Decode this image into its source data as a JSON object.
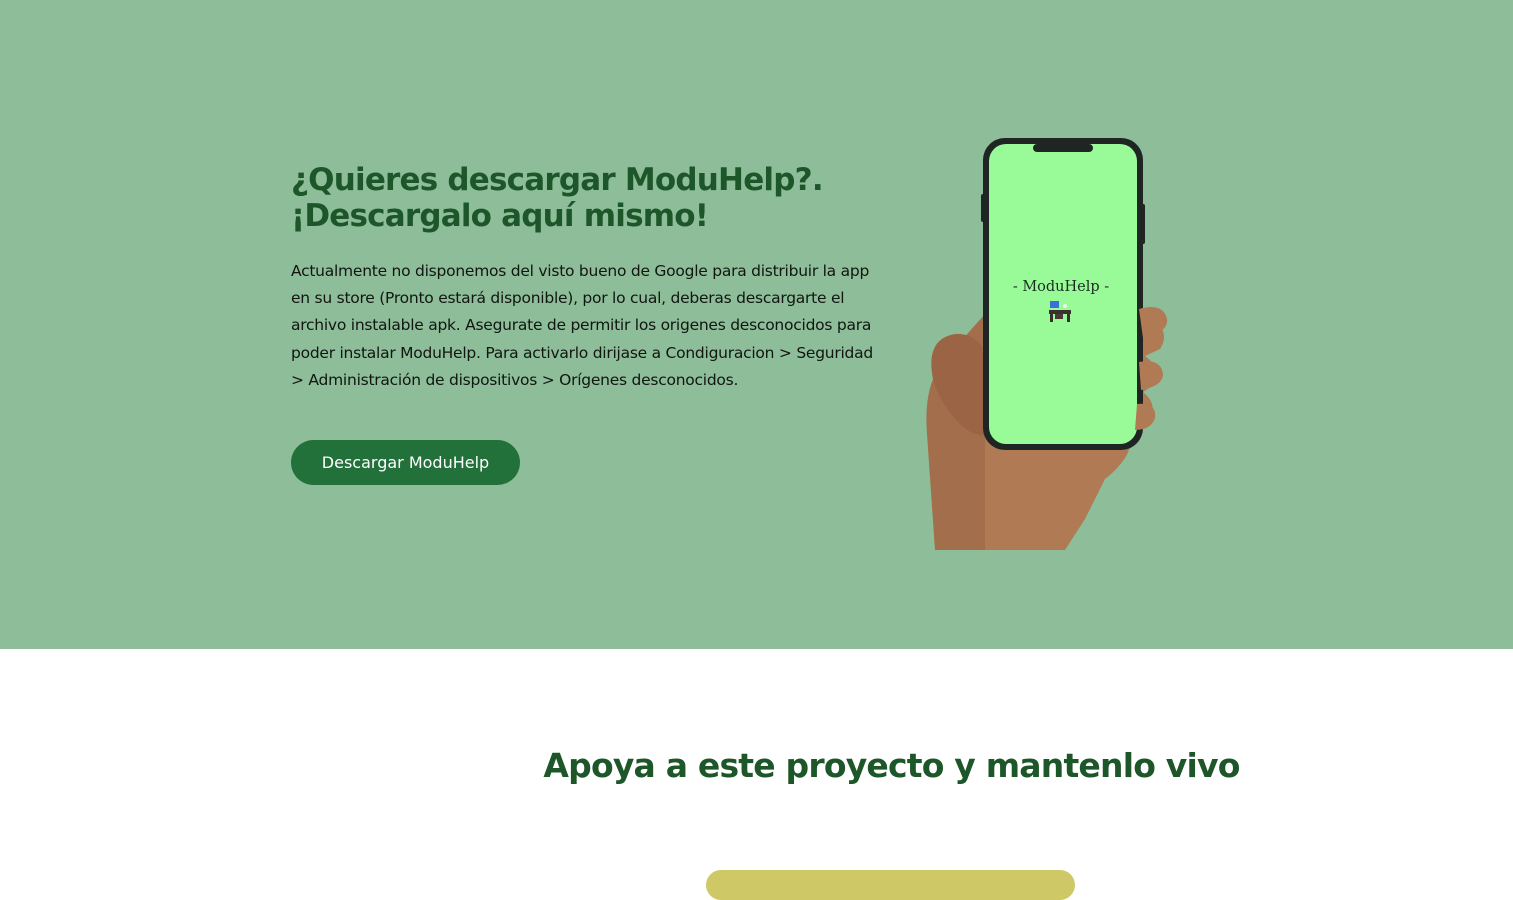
{
  "hero": {
    "title_line1": "¿Quieres descargar ModuHelp?.",
    "title_line2": "¡Descargalo aquí mismo!",
    "description": "Actualmente no disponemos del visto bueno de Google para distribuir la app en su store (Pronto estará disponible), por lo cual, deberas descargarte el archivo instalable apk. Asegurate de permitir los origenes desconocidos para poder instalar ModuHelp. Para activarlo dirijase a Condiguracion > Seguridad > Administración de dispositivos > Orígenes desconocidos.",
    "button_label": "Descargar ModuHelp",
    "phone_screen_text": "- ModuHelp -",
    "phone_icon": "desk-with-computer-icon",
    "colors": {
      "background": "#8dbd99",
      "title": "#1d5628",
      "button": "#22703a",
      "phone_screen": "#98fb98"
    }
  },
  "support": {
    "title": "Apoya a este proyecto y mantenlo vivo",
    "button_color": "#cfc867"
  }
}
